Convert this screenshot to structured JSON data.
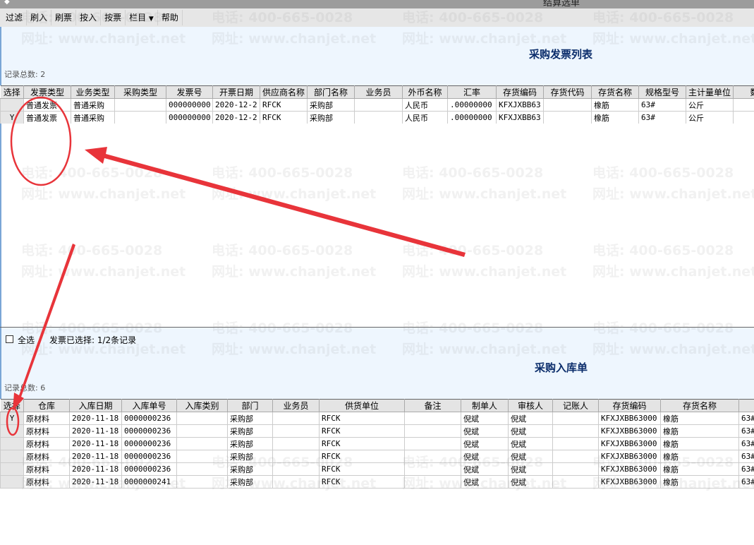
{
  "window": {
    "title": "结算选单"
  },
  "toolbar": {
    "items": [
      "过滤",
      "刷入",
      "刷票",
      "按入",
      "按票",
      "栏目",
      "帮助"
    ]
  },
  "invoice_panel": {
    "title": "采购发票列表",
    "record_count": "记录总数: 2",
    "columns": [
      "选择",
      "发票类型",
      "业务类型",
      "采购类型",
      "发票号",
      "开票日期",
      "供应商名称",
      "部门名称",
      "业务员",
      "外币名称",
      "汇率",
      "存货编码",
      "存货代码",
      "存货名称",
      "规格型号",
      "主计量单位",
      "数"
    ],
    "rows": [
      [
        "",
        "普通发票",
        "普通采购",
        "",
        "000000000",
        "2020-12-2",
        "RFCK",
        "采购部",
        "",
        "人民币",
        ".00000000",
        "KFXJXBB63",
        "",
        "橡筋",
        "63#",
        "公斤",
        ""
      ],
      [
        "Y",
        "普通发票",
        "普通采购",
        "",
        "000000000",
        "2020-12-2",
        "RFCK",
        "采购部",
        "",
        "人民币",
        ".00000000",
        "KFXJXBB63",
        "",
        "橡筋",
        "63#",
        "公斤",
        ""
      ]
    ]
  },
  "selection": {
    "select_all": "全选",
    "selected_info": "发票已选择: 1/2条记录",
    "select_all_checked": false
  },
  "receipt_panel": {
    "title": "采购入库单",
    "record_count": "记录总数: 6",
    "columns": [
      "选择",
      "仓库",
      "入库日期",
      "入库单号",
      "入库类别",
      "部门",
      "业务员",
      "供货单位",
      "备注",
      "制单人",
      "审核人",
      "记账人",
      "存货编码",
      "存货名称",
      ""
    ],
    "rows": [
      [
        "Y",
        "原材料",
        "2020-11-18",
        "0000000236",
        "",
        "采购部",
        "",
        "RFCK",
        "",
        "倪斌",
        "倪斌",
        "",
        "KFXJXBB63000",
        "橡筋",
        "63#"
      ],
      [
        "",
        "原材料",
        "2020-11-18",
        "0000000236",
        "",
        "采购部",
        "",
        "RFCK",
        "",
        "倪斌",
        "倪斌",
        "",
        "KFXJXBB63000",
        "橡筋",
        "63#"
      ],
      [
        "",
        "原材料",
        "2020-11-18",
        "0000000236",
        "",
        "采购部",
        "",
        "RFCK",
        "",
        "倪斌",
        "倪斌",
        "",
        "KFXJXBB63000",
        "橡筋",
        "63#"
      ],
      [
        "",
        "原材料",
        "2020-11-18",
        "0000000236",
        "",
        "采购部",
        "",
        "RFCK",
        "",
        "倪斌",
        "倪斌",
        "",
        "KFXJXBB63000",
        "橡筋",
        "63#"
      ],
      [
        "",
        "原材料",
        "2020-11-18",
        "0000000236",
        "",
        "采购部",
        "",
        "RFCK",
        "",
        "倪斌",
        "倪斌",
        "",
        "KFXJXBB63000",
        "橡筋",
        "63#"
      ],
      [
        "",
        "原材料",
        "2020-11-18",
        "0000000241",
        "",
        "采购部",
        "",
        "RFCK",
        "",
        "倪斌",
        "倪斌",
        "",
        "KFXJXBB63000",
        "橡筋",
        "63#"
      ]
    ]
  },
  "watermark": {
    "phone": "电话: 400-665-0028",
    "site": "网址: www.chanjet.net"
  },
  "colors": {
    "panel_bg": "#eef6fe",
    "title_blue": "#0b2d6b",
    "annotation_red": "#e8343a"
  }
}
